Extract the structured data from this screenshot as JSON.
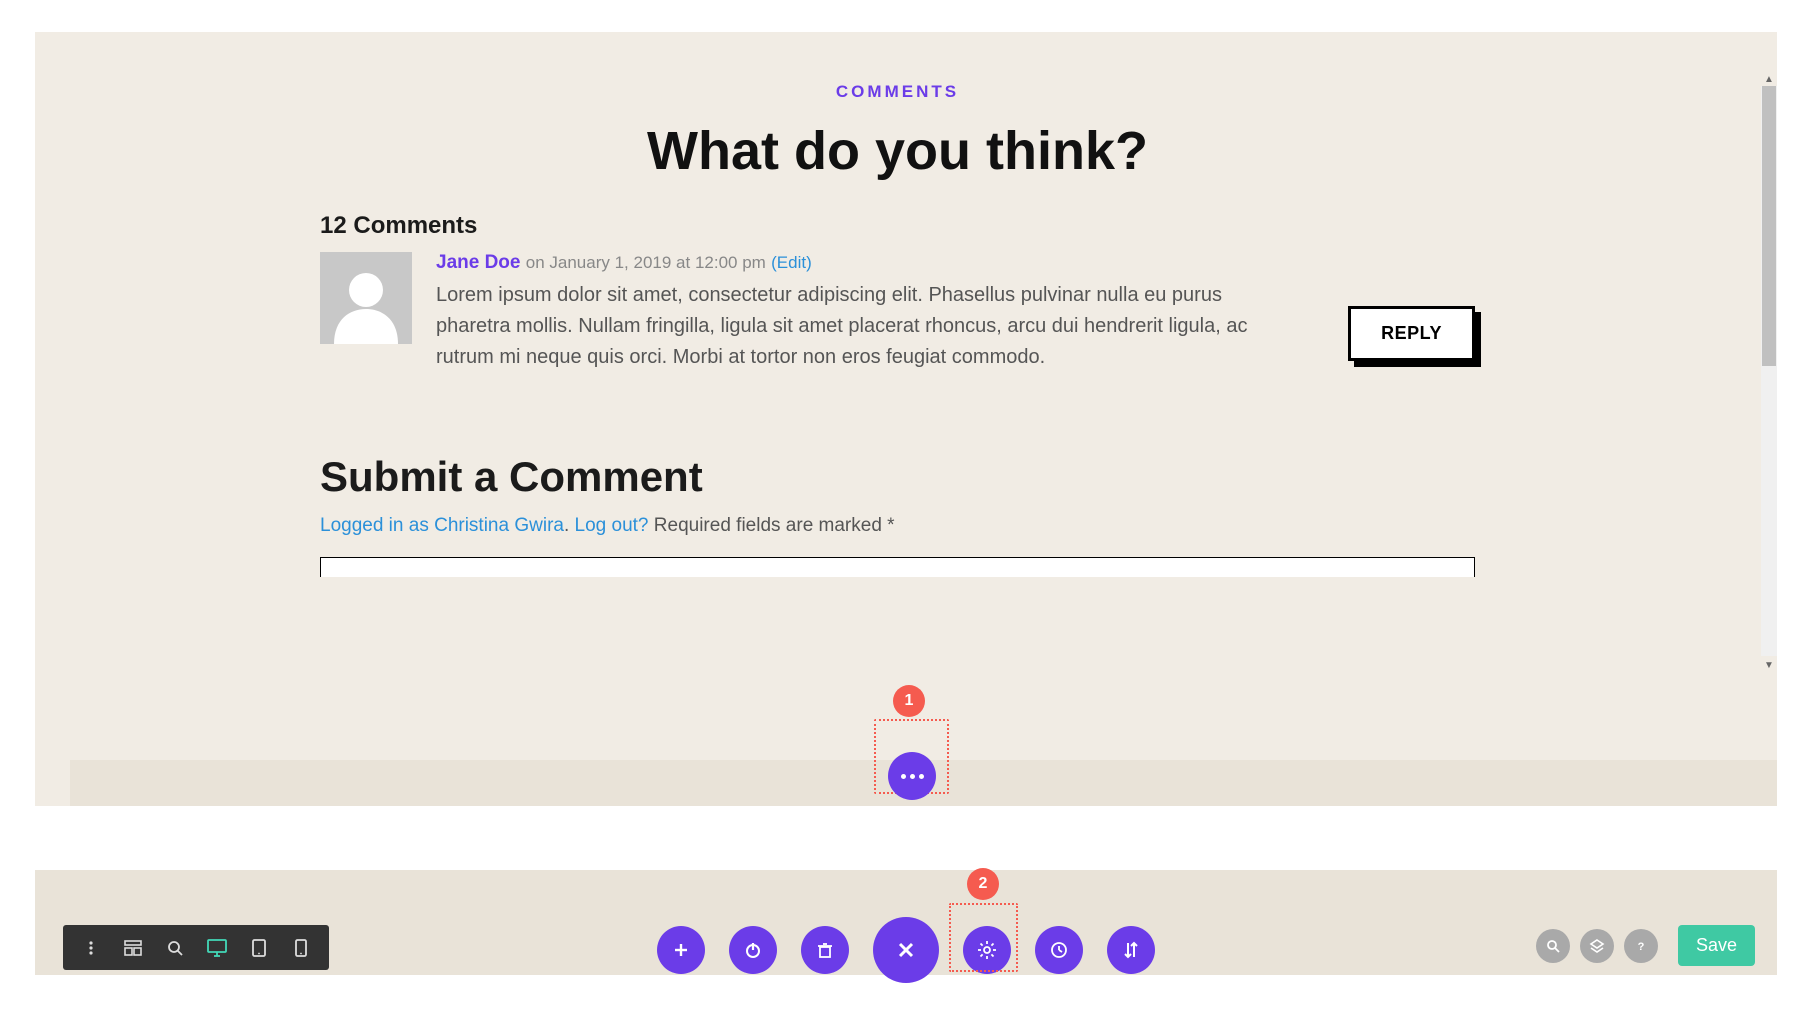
{
  "eyebrow": "COMMENTS",
  "title": "What do you think?",
  "comment_count_label": "12 Comments",
  "comment": {
    "author": "Jane Doe",
    "meta": "on January 1, 2019 at 12:00 pm",
    "edit": "(Edit)",
    "body": "Lorem ipsum dolor sit amet, consectetur adipiscing elit. Phasellus pulvinar nulla eu purus pharetra mollis. Nullam fringilla, ligula sit amet placerat rhoncus, arcu dui hendrerit ligula, ac rutrum mi neque quis orci. Morbi at tortor non eros feugiat commodo.",
    "reply": "REPLY"
  },
  "submit": {
    "heading": "Submit a Comment",
    "logged_in_as": "Logged in as Christina Gwira",
    "logout": "Log out?",
    "required_note": " Required fields are marked *"
  },
  "badges": {
    "one": "1",
    "two": "2"
  },
  "save_label": "Save",
  "period": "."
}
